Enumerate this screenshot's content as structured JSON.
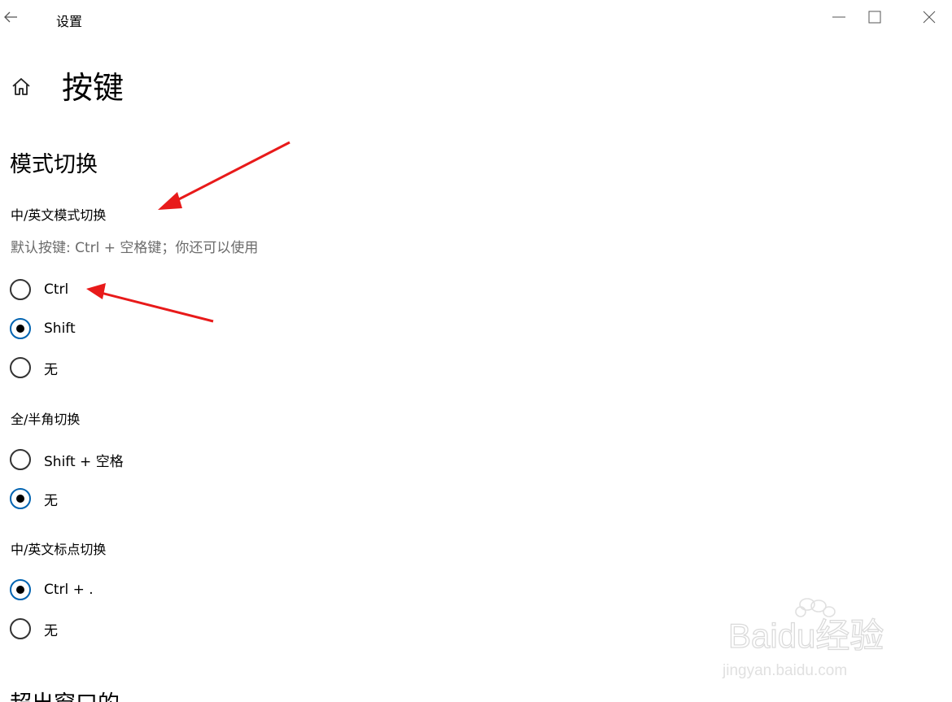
{
  "window": {
    "title": "设置"
  },
  "page": {
    "title": "按键"
  },
  "section": {
    "title": "模式切换"
  },
  "groups": {
    "mode_switch": {
      "label": "中/英文模式切换",
      "description": "默认按键: Ctrl + 空格键；你还可以使用",
      "options": [
        {
          "label": "Ctrl",
          "checked": false
        },
        {
          "label": "Shift",
          "checked": true
        },
        {
          "label": "无",
          "checked": false
        }
      ]
    },
    "width_switch": {
      "label": "全/半角切换",
      "options": [
        {
          "label": "Shift + 空格",
          "checked": false
        },
        {
          "label": "无",
          "checked": true
        }
      ]
    },
    "punct_switch": {
      "label": "中/英文标点切换",
      "options": [
        {
          "label": "Ctrl + .",
          "checked": true
        },
        {
          "label": "无",
          "checked": false
        }
      ]
    }
  },
  "next_section": {
    "title": "超出窗口的"
  },
  "watermark": {
    "brand": "Baidu经验",
    "url": "jingyan.baidu.com"
  },
  "colors": {
    "accent": "#0063b1",
    "annotation_arrow": "#e81a1a",
    "secondary_text": "#6b6b6b"
  }
}
